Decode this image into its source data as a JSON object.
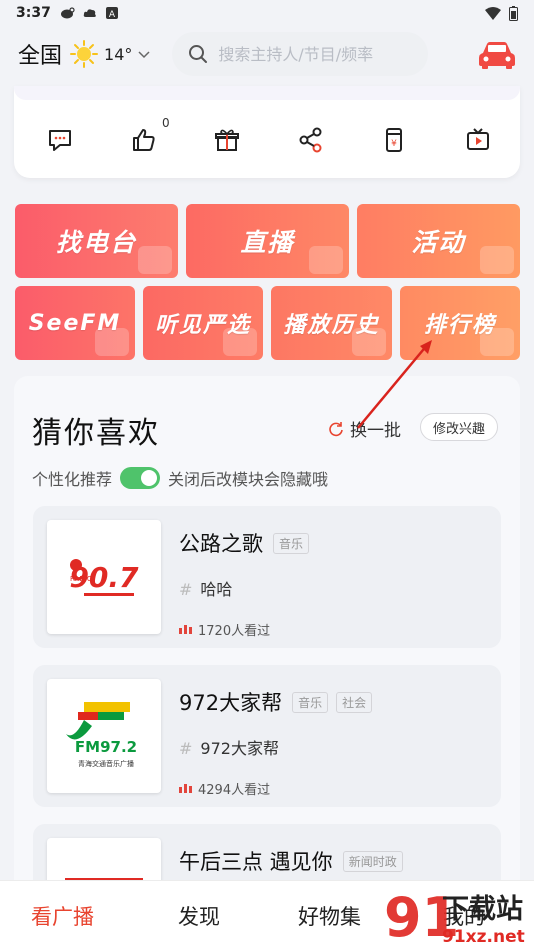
{
  "status_bar": {
    "time": "3:37"
  },
  "header": {
    "region": "全国",
    "temperature": "14°",
    "search_placeholder": "搜索主持人/节目/频率"
  },
  "quick_actions": {
    "like_count": "0"
  },
  "tiles": [
    {
      "label": "找电台",
      "color_from": "#fb5c6a",
      "color_to": "#fd7d6e"
    },
    {
      "label": "直播",
      "color_from": "#fd6a63",
      "color_to": "#fe8866"
    },
    {
      "label": "活动",
      "color_from": "#ff7d63",
      "color_to": "#ff9a62"
    },
    {
      "label": "SeeFM",
      "color_from": "#fb5c6a",
      "color_to": "#fd7468"
    },
    {
      "label": "听见严选",
      "color_from": "#fc6963",
      "color_to": "#fe7c66"
    },
    {
      "label": "播放历史",
      "color_from": "#fd7763",
      "color_to": "#ff8966"
    },
    {
      "label": "排行榜",
      "color_from": "#ff8a62",
      "color_to": "#ff9f66"
    }
  ],
  "recommend": {
    "title": "猜你喜欢",
    "refresh_label": "换一批",
    "modify_label": "修改兴趣",
    "personalized_label": "个性化推荐",
    "personalized_note": "关闭后改模块会隐藏哦",
    "items": [
      {
        "title": "公路之歌",
        "tags": [
          "音乐"
        ],
        "subtitle": "哈哈",
        "views": "1720人看过",
        "logo_text": "90.7",
        "logo_sub": "RADIO"
      },
      {
        "title": "972大家帮",
        "tags": [
          "音乐",
          "社会"
        ],
        "subtitle": "972大家帮",
        "views": "4294人看过",
        "logo_text": "FM97.2",
        "logo_sub": "青海交通音乐广播"
      },
      {
        "title": "午后三点 遇见你",
        "tags": [
          "新闻时政"
        ],
        "subtitle": "",
        "views": "",
        "logo_text": "",
        "logo_sub": ""
      }
    ]
  },
  "bottom_nav": [
    {
      "label": "看广播",
      "active": true
    },
    {
      "label": "发现",
      "active": false
    },
    {
      "label": "好物集",
      "active": false
    },
    {
      "label": "我的",
      "active": false
    }
  ],
  "watermark": {
    "text": "下载站",
    "url_text": "91xz.net",
    "badge": "91"
  },
  "colors": {
    "accent": "#e8442f",
    "toggle_on": "#4fc36b"
  }
}
